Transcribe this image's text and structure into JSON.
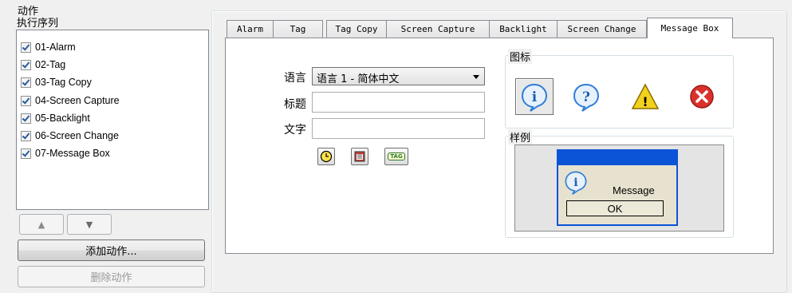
{
  "window": {
    "title": "动作"
  },
  "sequence": {
    "label": "执行序列",
    "items": [
      {
        "label": "01-Alarm",
        "checked": true
      },
      {
        "label": "02-Tag",
        "checked": true
      },
      {
        "label": "03-Tag Copy",
        "checked": true
      },
      {
        "label": "04-Screen Capture",
        "checked": true
      },
      {
        "label": "05-Backlight",
        "checked": true
      },
      {
        "label": "06-Screen Change",
        "checked": true
      },
      {
        "label": "07-Message Box",
        "checked": true
      }
    ],
    "up_glyph": "▲",
    "down_glyph": "▼",
    "add_action": "添加动作...",
    "delete_action": "删除动作"
  },
  "tabs": [
    {
      "label": "Alarm",
      "active": false
    },
    {
      "label": "Tag",
      "active": false
    },
    {
      "label": "Tag Copy",
      "active": false
    },
    {
      "label": "Screen Capture",
      "active": false
    },
    {
      "label": "Backlight",
      "active": false
    },
    {
      "label": "Screen Change",
      "active": false
    },
    {
      "label": "Message Box",
      "active": true
    }
  ],
  "message_box": {
    "language_label": "语言",
    "language_value": "语言 1 - 简体中文",
    "title_label": "标题",
    "title_value": "",
    "text_label": "文字",
    "text_value": "",
    "tool_icons": [
      "clock-icon",
      "calendar-icon",
      "tag-icon"
    ],
    "tag_glyph_text": "TAG",
    "icon_group_label": "图标",
    "icons": [
      {
        "name": "info-icon",
        "glyph": "i",
        "selected": true
      },
      {
        "name": "question-icon",
        "glyph": "?",
        "selected": false
      },
      {
        "name": "warning-icon",
        "glyph": "!",
        "selected": false
      },
      {
        "name": "error-icon",
        "glyph": "×",
        "selected": false
      }
    ],
    "preview_label": "样例",
    "preview_message": "Message",
    "preview_ok": "OK"
  },
  "colors": {
    "preview_titlebar": "#0b53d7",
    "info_blue": "#2f7fd6",
    "warning_yellow": "#f3d21e",
    "error_red": "#d9322b"
  }
}
